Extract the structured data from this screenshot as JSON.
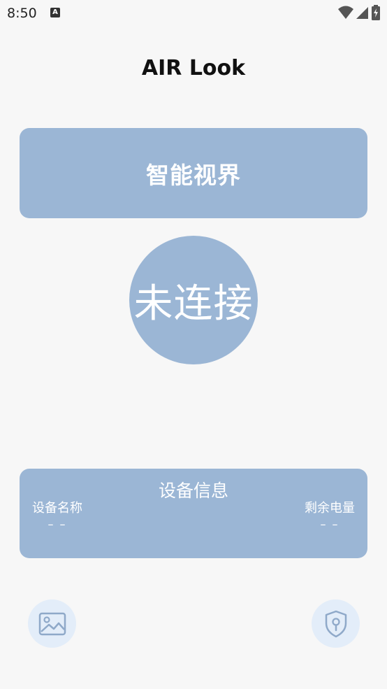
{
  "status_bar": {
    "time": "8:50",
    "notification_icon": "a-icon",
    "icons": [
      "wifi-icon",
      "signal-icon",
      "battery-charging-icon"
    ]
  },
  "app": {
    "title": "AIR Look"
  },
  "vision_card": {
    "label": "智能视界"
  },
  "connection": {
    "status_label": "未连接"
  },
  "device_info": {
    "title": "设备信息",
    "name_label": "设备名称",
    "name_value": "– –",
    "battery_label": "剩余电量",
    "battery_value": "– –"
  },
  "bottom_actions": [
    {
      "icon": "gallery-icon"
    },
    {
      "icon": "shield-icon"
    }
  ],
  "colors": {
    "background": "#f7f7f7",
    "card": "#9bb6d5",
    "button_bg": "#e3edf9",
    "icon_stroke": "#8fa9c9"
  }
}
